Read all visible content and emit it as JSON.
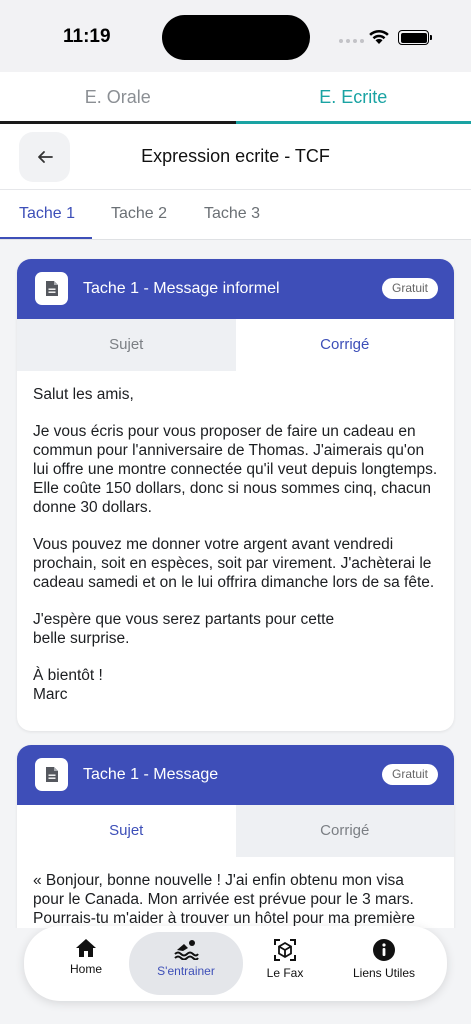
{
  "status": {
    "time": "11:19"
  },
  "mode_tabs": [
    {
      "label": "E. Orale"
    },
    {
      "label": "E. Ecrite"
    }
  ],
  "header": {
    "title": "Expression ecrite - TCF"
  },
  "task_tabs": [
    {
      "label": "Tache 1"
    },
    {
      "label": "Tache 2"
    },
    {
      "label": "Tache 3"
    }
  ],
  "cards": [
    {
      "title": "Tache 1 - Message informel",
      "badge": "Gratuit",
      "tabs": {
        "subject": "Sujet",
        "corrected": "Corrigé"
      },
      "paragraphs": [
        "Salut les amis,",
        "Je vous écris pour vous proposer de faire un cadeau en commun pour l'anniversaire de Thomas. J'aimerais qu'on lui offre une montre connectée qu'il veut depuis longtemps. Elle coûte 150 dollars, donc si nous sommes cinq, chacun donne 30 dollars.",
        "Vous pouvez me donner votre argent avant vendredi prochain, soit en espèces, soit par virement. J'achèterai le cadeau samedi et on le lui offrira dimanche lors de sa fête.",
        "J'espère que vous serez partants pour cette belle surprise.",
        "À bientôt !",
        "Marc"
      ]
    },
    {
      "title": "Tache 1 - Message",
      "badge": "Gratuit",
      "tabs": {
        "subject": "Sujet",
        "corrected": "Corrigé"
      },
      "paragraphs": [
        "« Bonjour, bonne nouvelle ! J'ai enfin obtenu mon visa pour le Canada. Mon arrivée est prévue pour le 3 mars. Pourrais-tu m'aider à trouver un hôtel pour ma première"
      ]
    }
  ],
  "bottom_nav": [
    {
      "label": "Home",
      "icon": "home-icon"
    },
    {
      "label": "S'entrainer",
      "icon": "swimmer-icon"
    },
    {
      "label": "Le Fax",
      "icon": "ar-cube-icon"
    },
    {
      "label": "Liens Utiles",
      "icon": "info-icon"
    }
  ],
  "colors": {
    "primary": "#3e4eb8",
    "accent_teal": "#1aa3a3"
  }
}
